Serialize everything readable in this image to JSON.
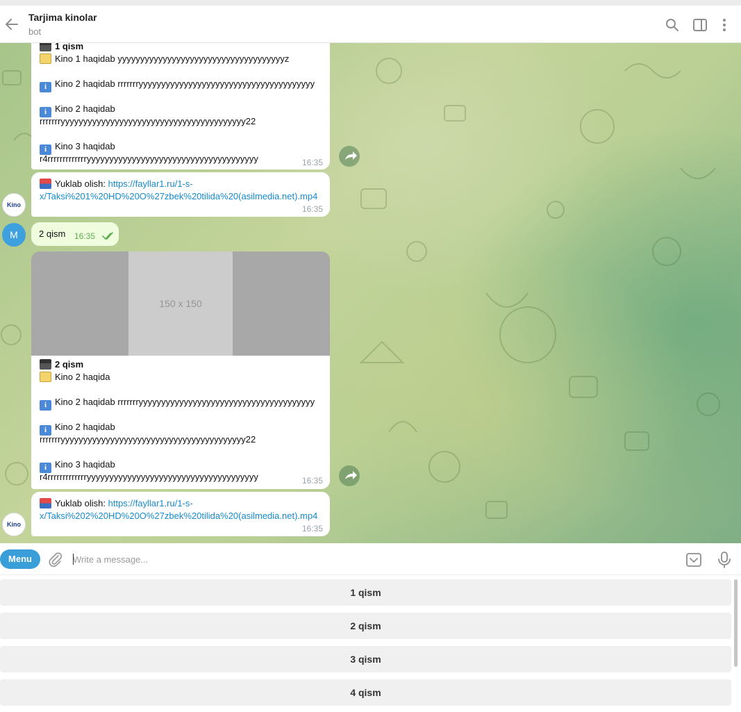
{
  "header": {
    "title": "Tarjima kinolar",
    "status": "bot"
  },
  "messages": {
    "m1": {
      "title": "1 qism",
      "line1": "Kino 1 haqidab yyyyyyyyyyyyyyyyyyyyyyyyyyyyyyyyyyyyyz",
      "line2": "Kino 2 haqidab rrrrrrryyyyyyyyyyyyyyyyyyyyyyyyyyyyyyyyyyyyyyy",
      "line3a": "Kino 2 haqidab",
      "line3b": "rrrrrrryyyyyyyyyyyyyyyyyyyyyyyyyyyyyyyyyyyyyyyyy22",
      "line4a": "Kino 3 haqidab",
      "line4b": "r4rrrrrrrrrrrrryyyyyyyyyyyyyyyyyyyyyyyyyyyyyyyyyyyyyy",
      "time": "16:35"
    },
    "m1_link": {
      "prefix": "Yuklab olish: ",
      "link1": "https://fayllar1.ru/1-s-",
      "link2": "x/Taksi%201%20HD%20O%27zbek%20tilida%20(asilmedia.net).mp4",
      "time": "16:35"
    },
    "out": {
      "text": "2 qism",
      "time": "16:35"
    },
    "media_placeholder": "150 x 150",
    "m2": {
      "title": "2 qism",
      "line1": "Kino 2 haqida",
      "line2": "Kino 2 haqidab rrrrrrryyyyyyyyyyyyyyyyyyyyyyyyyyyyyyyyyyyyyyy",
      "line3a": "Kino 2 haqidab",
      "line3b": "rrrrrrryyyyyyyyyyyyyyyyyyyyyyyyyyyyyyyyyyyyyyyyy22",
      "line4a": "Kino 3 haqidab",
      "line4b": "r4rrrrrrrrrrrrryyyyyyyyyyyyyyyyyyyyyyyyyyyyyyyyyyyyyy",
      "time": "16:35"
    },
    "m2_link": {
      "prefix": "Yuklab olish: ",
      "link1": "https://fayllar1.ru/1-s-",
      "link2": "x/Taksi%202%20HD%20O%27zbek%20tilida%20(asilmedia.net).mp4",
      "time": "16:35"
    }
  },
  "avatars": {
    "bot": "Kino",
    "user": "M"
  },
  "composer": {
    "menu_label": "Menu",
    "placeholder": "Write a message..."
  },
  "keyboard": {
    "buttons": [
      "1 qism",
      "2 qism",
      "3 qism",
      "4 qism"
    ]
  },
  "colors": {
    "accent": "#3a9fd8",
    "link": "#168acd",
    "outgoing_bubble": "#effdde"
  }
}
